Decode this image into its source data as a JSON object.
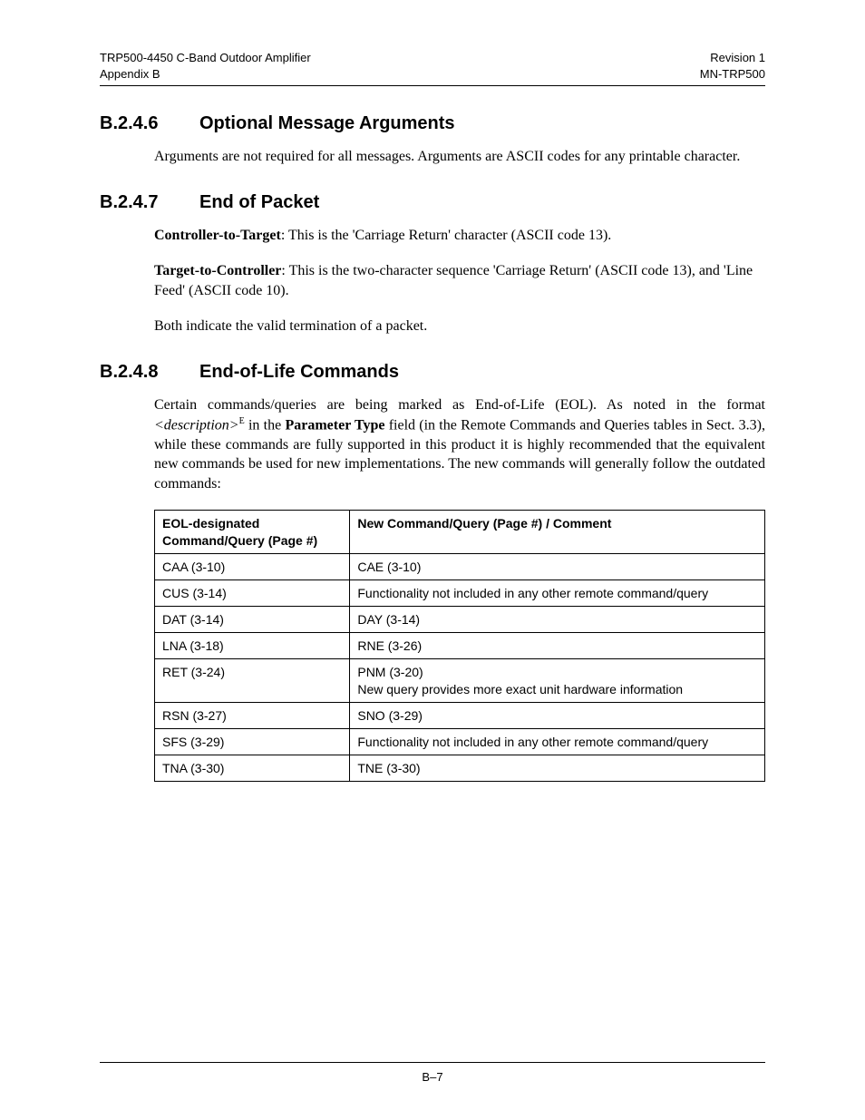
{
  "header": {
    "left_line1": "TRP500-4450 C-Band Outdoor Amplifier",
    "left_line2": "Appendix B",
    "right_line1": "Revision 1",
    "right_line2": "MN-TRP500"
  },
  "sections": {
    "s1": {
      "num": "B.2.4.6",
      "title": "Optional Message Arguments",
      "p1": "Arguments are not required for all messages. Arguments are ASCII codes for any printable character."
    },
    "s2": {
      "num": "B.2.4.7",
      "title": "End of Packet",
      "p1_bold": "Controller-to-Target",
      "p1_rest": ": This is the 'Carriage Return' character (ASCII code 13).",
      "p2_bold": "Target-to-Controller",
      "p2_rest": ": This is the two-character sequence 'Carriage Return' (ASCII code 13), and 'Line Feed' (ASCII code 10).",
      "p3": "Both indicate the valid termination of a packet."
    },
    "s3": {
      "num": "B.2.4.8",
      "title": "End-of-Life Commands",
      "p1_a": "Certain commands/queries are being marked as End-of-Life (EOL). As noted in the format ",
      "p1_ital": "<description>",
      "p1_sup": "E",
      "p1_b": " in the ",
      "p1_bold": "Parameter Type",
      "p1_c": " field (in the Remote Commands and Queries tables in Sect. 3.3), while these commands are fully supported in this product it is highly recommended that the equivalent new commands be used for new implementations. The new commands will generally follow the outdated commands:"
    }
  },
  "table": {
    "header": {
      "col1_l1": "EOL-designated",
      "col1_l2": "Command/Query (Page #)",
      "col2": "New Command/Query (Page #) / Comment"
    },
    "rows": [
      {
        "c1": "CAA (3-10)",
        "c2": "CAE (3-10)"
      },
      {
        "c1": "CUS (3-14)",
        "c2": "Functionality not included in any other remote command/query"
      },
      {
        "c1": "DAT (3-14)",
        "c2": "DAY (3-14)"
      },
      {
        "c1": "LNA (3-18)",
        "c2": "RNE (3-26)"
      },
      {
        "c1": "RET (3-24)",
        "c2": "PNM (3-20)\nNew query provides more exact unit hardware information"
      },
      {
        "c1": "RSN (3-27)",
        "c2": "SNO (3-29)"
      },
      {
        "c1": "SFS (3-29)",
        "c2": "Functionality not included in any other remote command/query"
      },
      {
        "c1": "TNA (3-30)",
        "c2": "TNE (3-30)"
      }
    ]
  },
  "footer": {
    "page_num": "B–7"
  }
}
